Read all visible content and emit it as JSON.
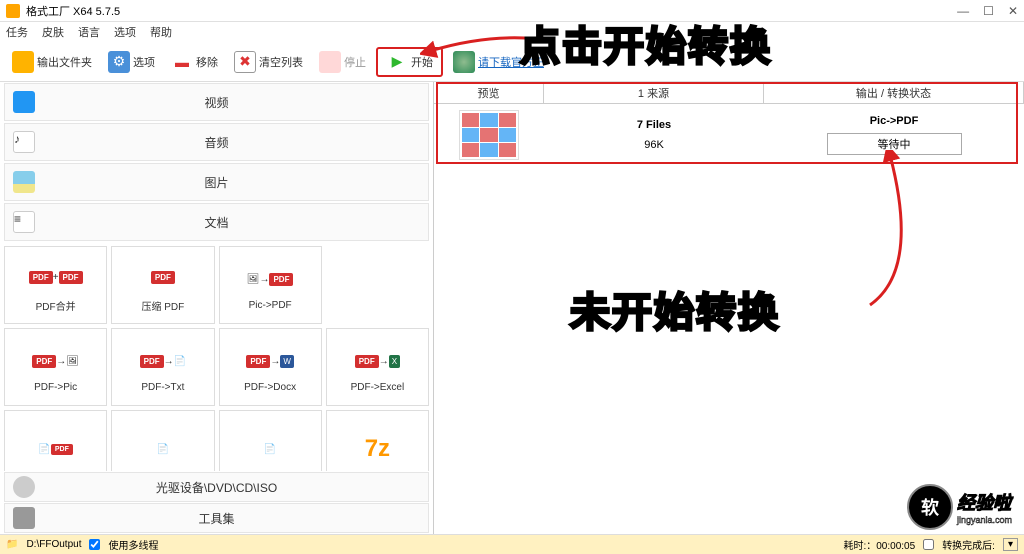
{
  "window": {
    "title": "格式工厂 X64 5.7.5"
  },
  "menu": [
    "任务",
    "皮肤",
    "语言",
    "选项",
    "帮助"
  ],
  "toolbar": {
    "output_folder": "输出文件夹",
    "options": "选项",
    "remove": "移除",
    "clear_list": "清空列表",
    "stop": "停止",
    "start": "开始",
    "official_link": "请下载官方正"
  },
  "categories": {
    "video": "视频",
    "audio": "音频",
    "image": "图片",
    "document": "文档",
    "optical": "光驱设备\\DVD\\CD\\ISO",
    "toolbox": "工具集"
  },
  "tiles": [
    "PDF合并",
    "压缩 PDF",
    "Pic->PDF",
    "",
    "PDF->Pic",
    "PDF->Txt",
    "PDF->Docx",
    "PDF->Excel"
  ],
  "table": {
    "headers": {
      "preview": "预览",
      "source": "1 来源",
      "output": "输出 / 转换状态"
    },
    "row": {
      "files": "7 Files",
      "size": "96K",
      "target": "Pic->PDF",
      "status": "等待中"
    }
  },
  "annotations": {
    "top": "点击开始转换",
    "mid": "未开始转换"
  },
  "statusbar": {
    "output_path": "D:\\FFOutput",
    "multithread": "使用多线程",
    "elapsed": "耗时:：00:00:05",
    "after_done": "转换完成后:"
  },
  "watermark": {
    "badge": "软",
    "text": "经验啦",
    "url": "jingyanla.com"
  }
}
